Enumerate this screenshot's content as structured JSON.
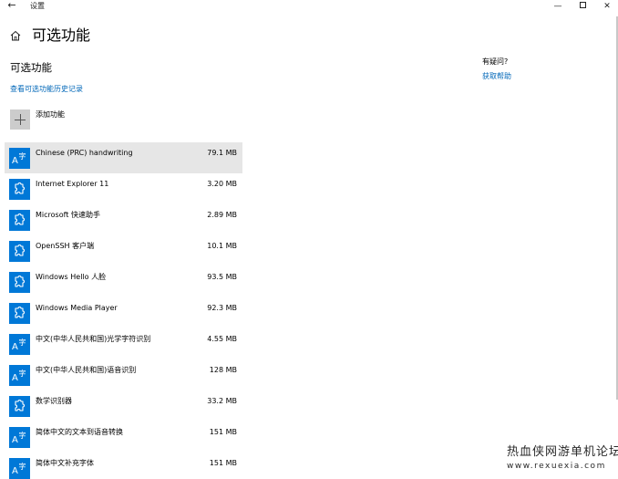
{
  "window": {
    "title": "设置",
    "back_glyph": "←",
    "minimize_glyph": "—",
    "close_glyph": "✕"
  },
  "header": {
    "title": "可选功能"
  },
  "main": {
    "section_title": "可选功能",
    "history_link": "查看可选功能历史记录",
    "add_feature_label": "添加功能",
    "features": [
      {
        "name": "Chinese (PRC) handwriting",
        "size": "79.1 MB",
        "icon": "font-icon",
        "selected": true
      },
      {
        "name": "Internet Explorer 11",
        "size": "3.20 MB",
        "icon": "puzzle-icon"
      },
      {
        "name": "Microsoft 快速助手",
        "size": "2.89 MB",
        "icon": "puzzle-icon"
      },
      {
        "name": "OpenSSH 客户端",
        "size": "10.1 MB",
        "icon": "puzzle-icon"
      },
      {
        "name": "Windows Hello 人脸",
        "size": "93.5 MB",
        "icon": "puzzle-icon"
      },
      {
        "name": "Windows Media Player",
        "size": "92.3 MB",
        "icon": "puzzle-icon"
      },
      {
        "name": "中文(中华人民共和国)光学字符识别",
        "size": "4.55 MB",
        "icon": "font-icon"
      },
      {
        "name": "中文(中华人民共和国)语音识别",
        "size": "128 MB",
        "icon": "font-icon"
      },
      {
        "name": "数学识别器",
        "size": "33.2 MB",
        "icon": "puzzle-icon"
      },
      {
        "name": "简体中文的文本到语音转换",
        "size": "151 MB",
        "icon": "font-icon"
      },
      {
        "name": "简体中文补充字体",
        "size": "151 MB",
        "icon": "font-icon"
      }
    ]
  },
  "help": {
    "title": "有疑问?",
    "link": "获取帮助"
  },
  "watermark": {
    "line1": "热血侠网游单机论坛",
    "line2": "www.rexuexia.com"
  },
  "colors": {
    "accent": "#0078d7",
    "link": "#0067b8",
    "selected_row": "#e6e6e6"
  }
}
